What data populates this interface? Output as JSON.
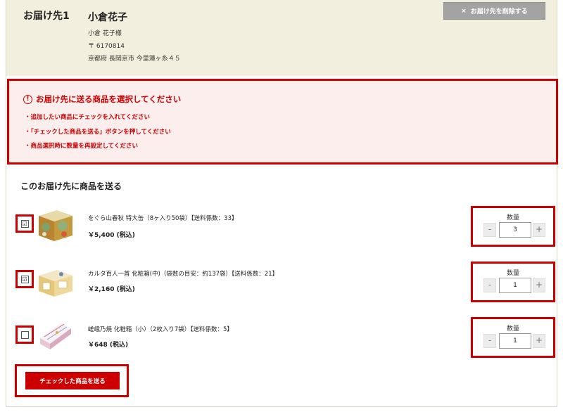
{
  "address": {
    "label": "お届け先1",
    "name": "小倉花子",
    "recipient": "小倉 花子様",
    "postal": "〒 6170814",
    "street": "京都府 長岡京市 今里蓮ヶ糸４５",
    "delete_icon": "close-icon",
    "delete_label": "お届け先を削除する"
  },
  "error": {
    "icon": "exclamation-circle-icon",
    "title": "お届け先に送る商品を選択してください",
    "items": [
      "・追加したい商品にチェックを入れてください",
      "・「チェックした商品を送る」ボタンを押してください",
      "・商品選択時に数量を再設定してください"
    ]
  },
  "section_title": "このお届け先に商品を送る",
  "products": [
    {
      "checked": true,
      "check_mark": "☑",
      "name": "をぐら山春秋 特大缶（8ヶ入り50袋）【送料係数：33】",
      "price": "￥5,400 (税込)",
      "qty_label": "数量",
      "qty": "3",
      "minus": "-",
      "plus": "+"
    },
    {
      "checked": true,
      "check_mark": "☑",
      "name": "カルタ百人一首 化粧箱(中)（袋数の目安：約137袋）【送料係数：21】",
      "price": "￥2,160 (税込)",
      "qty_label": "数量",
      "qty": "1",
      "minus": "-",
      "plus": "+"
    },
    {
      "checked": false,
      "check_mark": "",
      "name": "嵯峨乃焼 化粧箱（小）（2枚入り7袋）【送料係数：5】",
      "price": "￥648 (税込)",
      "qty_label": "数量",
      "qty": "1",
      "minus": "-",
      "plus": "+"
    }
  ],
  "send_label": "チェックした商品を送る",
  "colors": {
    "accent": "#cc0000",
    "header_bg": "#f3efdf",
    "error_bg": "#fdeeee"
  }
}
